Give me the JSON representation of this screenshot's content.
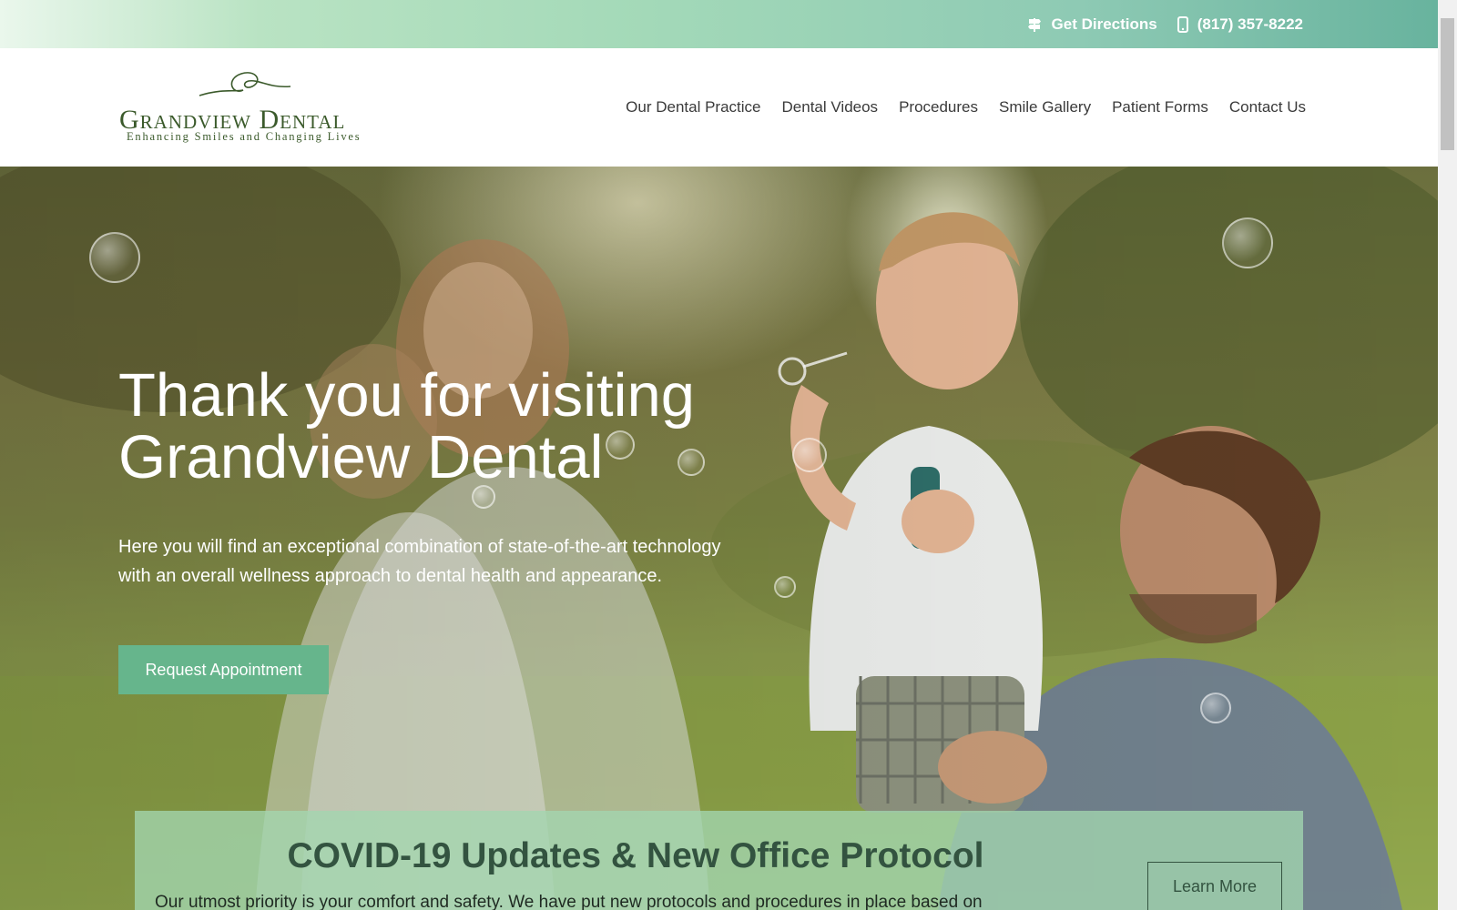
{
  "topbar": {
    "directions_label": "Get Directions",
    "phone_label": "(817) 357-8222"
  },
  "logo": {
    "name": "Grandview Dental",
    "tagline": "Enhancing Smiles and Changing Lives"
  },
  "nav": {
    "items": [
      {
        "label": "Our Dental Practice"
      },
      {
        "label": "Dental Videos"
      },
      {
        "label": "Procedures"
      },
      {
        "label": "Smile Gallery"
      },
      {
        "label": "Patient Forms"
      },
      {
        "label": "Contact Us"
      }
    ]
  },
  "hero": {
    "title_line1": "Thank you for visiting",
    "title_line2": "Grandview Dental",
    "text_line1": "Here you will find an exceptional combination of state-of-the-art technology",
    "text_line2": "with an overall wellness approach to dental health and appearance.",
    "cta_label": "Request Appointment"
  },
  "covid": {
    "title": "COVID-19 Updates & New Office Protocol",
    "text": "Our utmost priority is your comfort and safety. We have put new protocols and procedures in place based on",
    "button_label": "Learn More"
  },
  "colors": {
    "accent_green": "#66b58c",
    "dark_green": "#335340",
    "logo_green": "#3b5a2b"
  }
}
